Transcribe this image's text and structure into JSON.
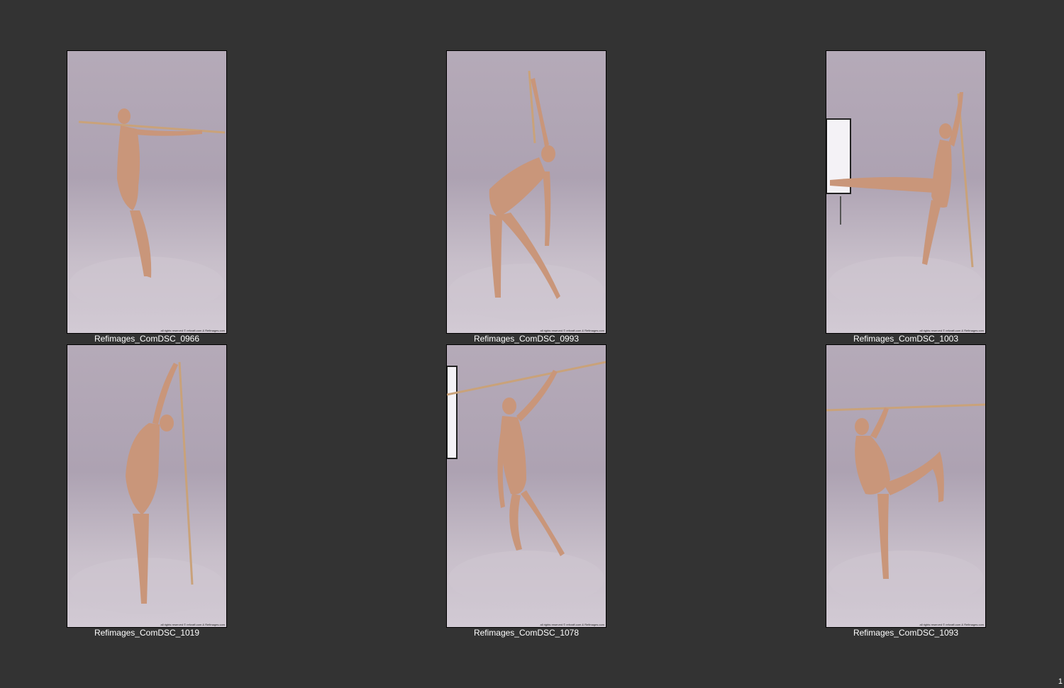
{
  "page": {
    "background_color": "#333333",
    "page_number": "1"
  },
  "credit_text": "all rights reserved © refcraft.com & Refimages.com",
  "thumbnails": [
    {
      "caption": "Refimages_ComDSC_0966"
    },
    {
      "caption": "Refimages_ComDSC_0993"
    },
    {
      "caption": "Refimages_ComDSC_1003"
    },
    {
      "caption": "Refimages_ComDSC_1019"
    },
    {
      "caption": "Refimages_ComDSC_1078"
    },
    {
      "caption": "Refimages_ComDSC_1093"
    }
  ]
}
